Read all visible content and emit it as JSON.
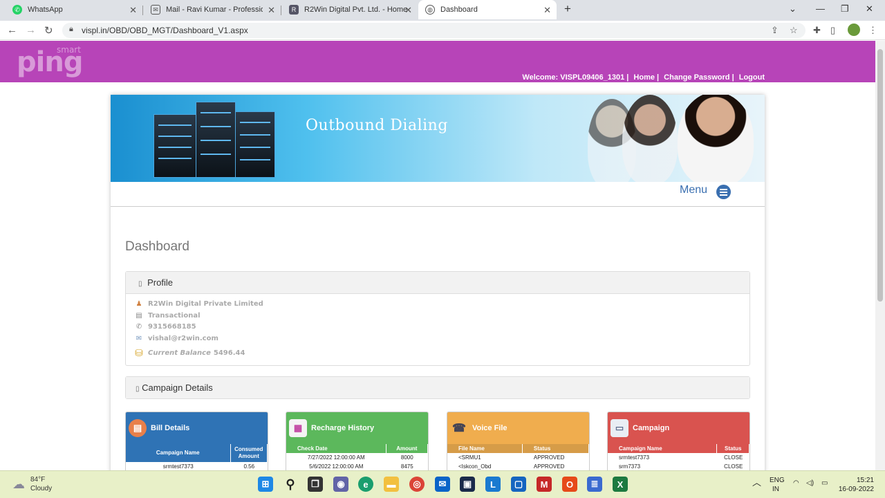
{
  "browser": {
    "tabs": [
      {
        "title": "WhatsApp",
        "icon": "whatsapp-icon"
      },
      {
        "title": "Mail - Ravi Kumar - Professional",
        "icon": "mail-icon"
      },
      {
        "title": "R2Win Digital Pvt. Ltd. - Home",
        "icon": "r2win-icon"
      },
      {
        "title": "Dashboard",
        "icon": "globe-icon"
      }
    ],
    "url": "vispl.in/OBD/OBD_MGT/Dashboard_V1.aspx"
  },
  "header": {
    "logo_smart": "smart",
    "logo_ping": "ping",
    "welcome": "Welcome: VISPL09406_1301 |",
    "home": "Home |",
    "change_password": "Change Password |",
    "logout": "Logout"
  },
  "banner": {
    "title": "Outbound Dialing"
  },
  "menu": {
    "label": "Menu"
  },
  "dashboard": {
    "title": "Dashboard"
  },
  "profile": {
    "heading": "Profile",
    "company": "R2Win Digital Private Limited",
    "type": "Transactional",
    "phone": "9315668185",
    "email": "vishal@r2win.com",
    "balance_label": "Current Balance",
    "balance_value": "5496.44"
  },
  "campaign_details": {
    "heading": "Campaign Details"
  },
  "cards": {
    "bill": {
      "title": "Bill Details",
      "color": "#2f73b5",
      "col1": "Campaign Name",
      "col2": "Consumed Amount",
      "rows": [
        {
          "c1": "srmtest7373",
          "c2": "0.56"
        }
      ]
    },
    "recharge": {
      "title": "Recharge History",
      "color": "#5cb85c",
      "col1": "Check Date",
      "col2": "Amount",
      "rows": [
        {
          "c1": "7/27/2022 12:00:00 AM",
          "c2": "8000"
        },
        {
          "c1": "5/6/2022 12:00:00 AM",
          "c2": "8475"
        }
      ]
    },
    "voice": {
      "title": "Voice File",
      "color": "#f0ad4e",
      "col1": "File Name",
      "col2": "Status",
      "rows": [
        {
          "c1": "<SRMU1",
          "c2": "APPROVED"
        },
        {
          "c1": "<Iskcon_Obd",
          "c2": "APPROVED"
        }
      ]
    },
    "campaign": {
      "title": "Campaign",
      "color": "#d9534f",
      "col1": "Campaign Name",
      "col2": "Status",
      "rows": [
        {
          "c1": "srmtest7373",
          "c2": "CLOSE"
        },
        {
          "c1": "srm7373",
          "c2": "CLOSE"
        }
      ]
    }
  },
  "taskbar": {
    "temperature": "84°F",
    "condition": "Cloudy",
    "lang1": "ENG",
    "lang2": "IN",
    "time": "15:21",
    "date": "16-09-2022"
  }
}
